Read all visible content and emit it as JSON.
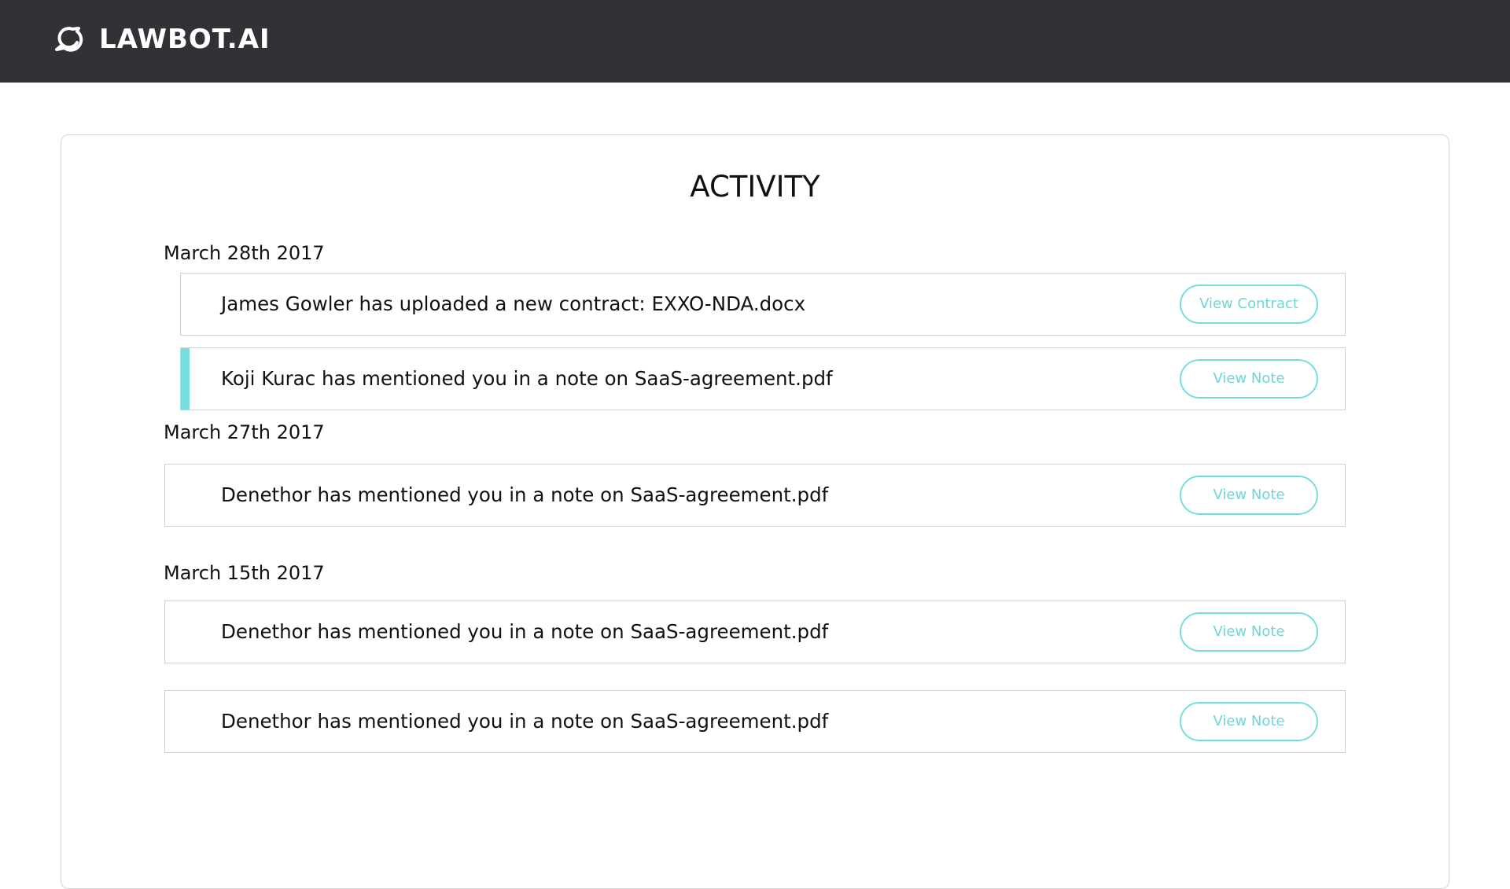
{
  "header": {
    "brand": "LAWBOT.AI",
    "logo_icon": "speech-bubble-swirl-icon"
  },
  "main": {
    "title": "ACTIVITY",
    "accent_color": "#76dede",
    "groups": [
      {
        "date": "March 28th 2017",
        "items": [
          {
            "text": "James Gowler has uploaded a new contract: EXXO-NDA.docx",
            "button": "View Contract",
            "highlighted": false
          },
          {
            "text": "Koji Kurac has mentioned you in a note on SaaS-agreement.pdf",
            "button": "View Note",
            "highlighted": true
          }
        ]
      },
      {
        "date": "March 27th 2017",
        "items": [
          {
            "text": "Denethor has mentioned you in a note on SaaS-agreement.pdf",
            "button": "View Note",
            "highlighted": false
          }
        ]
      },
      {
        "date": "March 15th 2017",
        "items": [
          {
            "text": "Denethor has mentioned you in a note on SaaS-agreement.pdf",
            "button": "View Note",
            "highlighted": false
          },
          {
            "text": "Denethor has mentioned you in a note on SaaS-agreement.pdf",
            "button": "View Note",
            "highlighted": false
          }
        ]
      }
    ]
  }
}
